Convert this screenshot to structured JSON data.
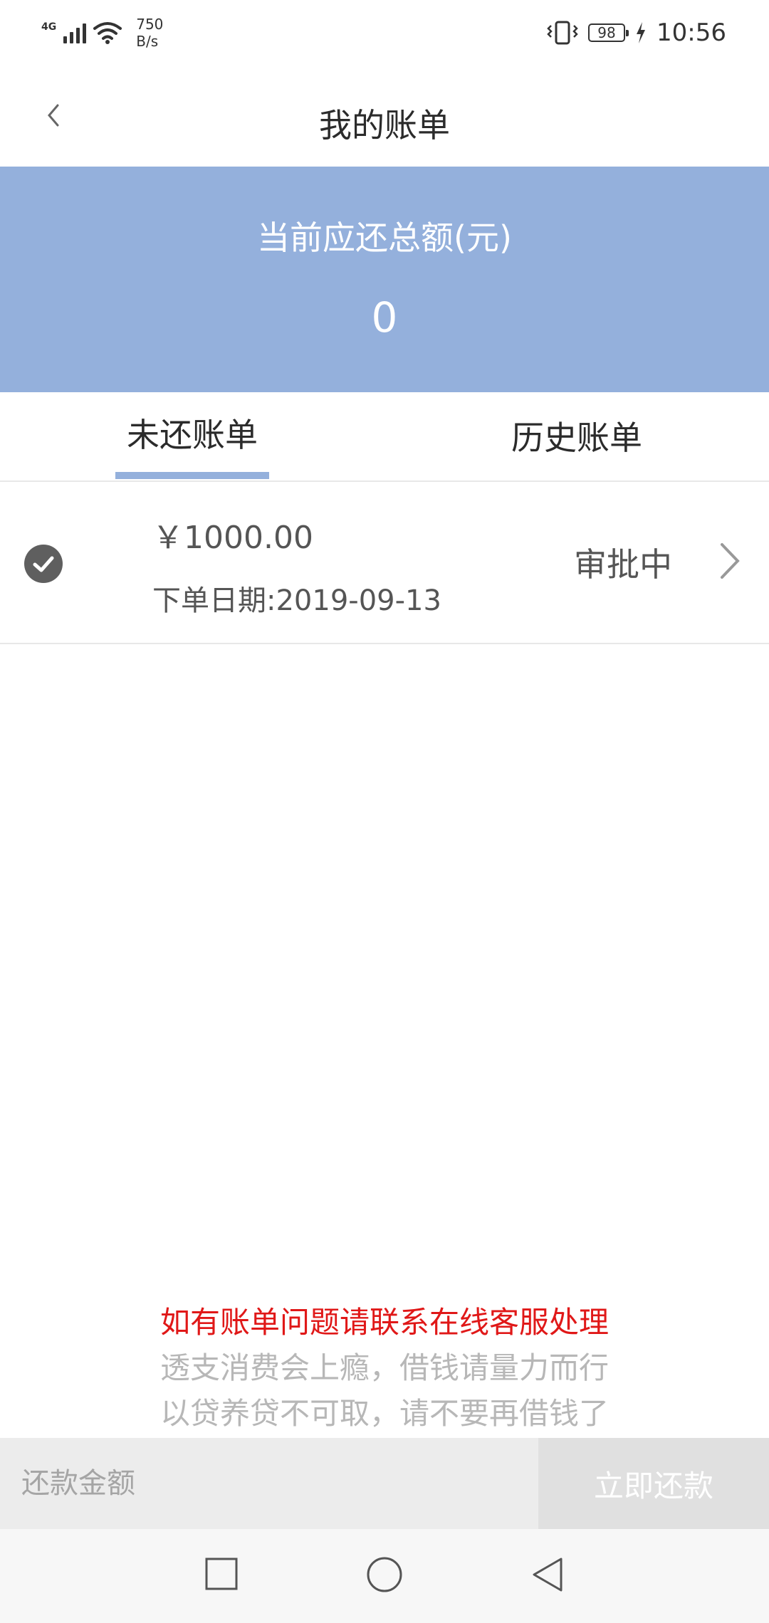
{
  "status_bar": {
    "network": "4G",
    "speed_value": "750",
    "speed_unit": "B/s",
    "battery": "98",
    "time": "10:56"
  },
  "header": {
    "title": "我的账单"
  },
  "summary": {
    "label": "当前应还总额(元)",
    "amount": "0"
  },
  "tabs": [
    {
      "label": "未还账单",
      "active": true
    },
    {
      "label": "历史账单",
      "active": false
    }
  ],
  "bills": [
    {
      "amount": "￥1000.00",
      "date": "下单日期:2019-09-13",
      "status": "审批中"
    }
  ],
  "notice": {
    "line1": "如有账单问题请联系在线客服处理",
    "line2": "透支消费会上瘾，借钱请量力而行",
    "line3": "以贷养贷不可取，请不要再借钱了"
  },
  "payment": {
    "input_placeholder": "还款金额",
    "input_value": "",
    "button_label": "立即还款"
  },
  "colors": {
    "accent": "#94b0dc",
    "notice_red": "#e01818",
    "muted": "#b7b7b7"
  }
}
